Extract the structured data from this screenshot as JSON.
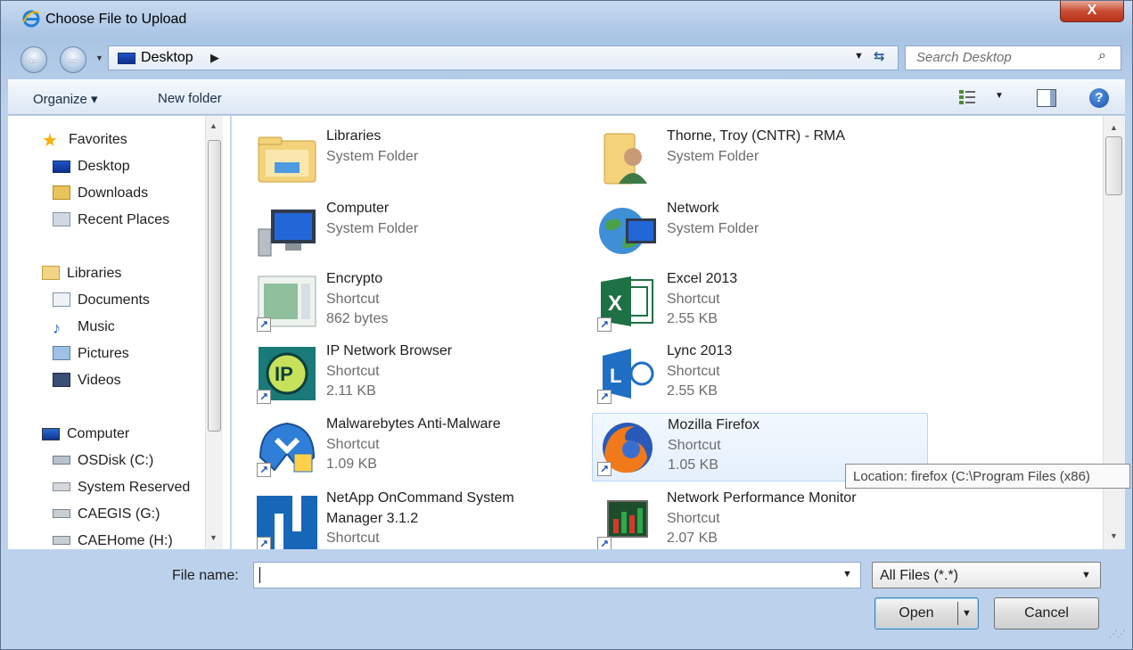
{
  "window": {
    "title": "Choose File to Upload",
    "close_glyph": "X"
  },
  "address": {
    "crumb": "Desktop",
    "crumb_arrow": "▶",
    "search_placeholder": "Search Desktop"
  },
  "toolbar": {
    "organize": "Organize ▾",
    "new_folder": "New folder",
    "help": "?"
  },
  "nav": {
    "favorites": "Favorites",
    "desktop": "Desktop",
    "downloads": "Downloads",
    "recent": "Recent Places",
    "libraries": "Libraries",
    "documents": "Documents",
    "music": "Music",
    "pictures": "Pictures",
    "videos": "Videos",
    "computer": "Computer",
    "osdisk": "OSDisk (C:)",
    "sysres": "System Reserved",
    "caegis": "CAEGIS (G:)",
    "caehome": "CAEHome (H:)"
  },
  "items": [
    {
      "name": "Libraries",
      "type": "System Folder",
      "size": ""
    },
    {
      "name": "Thorne, Troy (CNTR) - RMA",
      "type": "System Folder",
      "size": ""
    },
    {
      "name": "Computer",
      "type": "System Folder",
      "size": ""
    },
    {
      "name": "Network",
      "type": "System Folder",
      "size": ""
    },
    {
      "name": "Encrypto",
      "type": "Shortcut",
      "size": "862 bytes"
    },
    {
      "name": "Excel 2013",
      "type": "Shortcut",
      "size": "2.55 KB"
    },
    {
      "name": "IP Network Browser",
      "type": "Shortcut",
      "size": "2.11 KB"
    },
    {
      "name": "Lync 2013",
      "type": "Shortcut",
      "size": "2.55 KB"
    },
    {
      "name": "Malwarebytes Anti-Malware",
      "type": "Shortcut",
      "size": "1.09 KB"
    },
    {
      "name": "Mozilla Firefox",
      "type": "Shortcut",
      "size": "1.05 KB"
    },
    {
      "name": "NetApp OnCommand System",
      "name_line2": "Manager 3.1.2",
      "type": "Shortcut"
    },
    {
      "name": "Network Performance Monitor",
      "type": "Shortcut",
      "size": "2.07 KB"
    }
  ],
  "tooltip": "Location: firefox (C:\\Program Files (x86)",
  "footer": {
    "file_name_label": "File name:",
    "file_name_value": "",
    "filter": "All Files (*.*)",
    "open": "Open",
    "cancel": "Cancel"
  },
  "colors": {
    "accent": "#1a4faa",
    "selection": "#e5f0fc",
    "close": "#c84c32"
  }
}
